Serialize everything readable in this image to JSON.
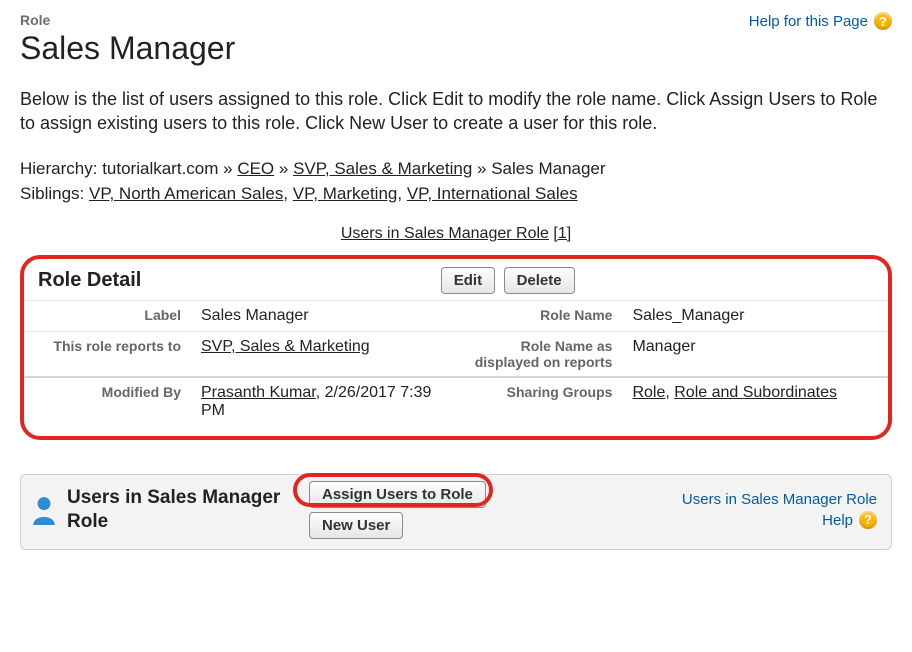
{
  "header": {
    "eyebrow": "Role",
    "title": "Sales Manager",
    "help_link": "Help for this Page"
  },
  "description": "Below is the list of users assigned to this role. Click Edit to modify the role name. Click Assign Users to Role to assign existing users to this role. Click New User to create a user for this role.",
  "hierarchy": {
    "label": "Hierarchy:",
    "root": "tutorialkart.com",
    "sep": " » ",
    "path": [
      "CEO",
      "SVP, Sales & Marketing"
    ],
    "current": "Sales Manager"
  },
  "siblings": {
    "label": "Siblings:",
    "items": [
      "VP, North American Sales",
      "VP, Marketing",
      "VP, International Sales"
    ]
  },
  "anchor": {
    "text": "Users in Sales Manager Role",
    "count": "[1]"
  },
  "detail": {
    "section_title": "Role Detail",
    "buttons": {
      "edit": "Edit",
      "delete": "Delete"
    },
    "rows": {
      "label_l": "Label",
      "label_v": "Sales Manager",
      "rolename_l": "Role Name",
      "rolename_v": "Sales_Manager",
      "reports_l": "This role reports to",
      "reports_v": "SVP, Sales & Marketing",
      "dispname_l": "Role Name as displayed on reports",
      "dispname_v": "Manager",
      "modby_l": "Modified By",
      "modby_name": "Prasanth Kumar",
      "modby_sep": ", ",
      "modby_time": "2/26/2017 7:39 PM",
      "sharing_l": "Sharing Groups",
      "sharing_v1": "Role",
      "sharing_sep": ", ",
      "sharing_v2": "Role and Subordinates"
    }
  },
  "users_section": {
    "title": "Users in Sales Manager Role",
    "buttons": {
      "assign": "Assign Users to Role",
      "newuser": "New User"
    },
    "help_line1": "Users in Sales Manager Role",
    "help_line2": "Help"
  }
}
